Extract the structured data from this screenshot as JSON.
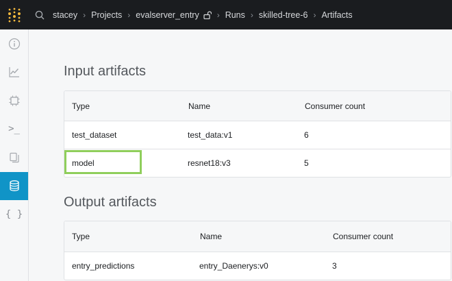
{
  "breadcrumb": {
    "user": "stacey",
    "projects": "Projects",
    "project": "evalserver_entry",
    "runs": "Runs",
    "run": "skilled-tree-6",
    "page": "Artifacts"
  },
  "sidebar": {
    "items": [
      {
        "name": "overview",
        "icon": "info-icon"
      },
      {
        "name": "charts",
        "icon": "line-chart-icon"
      },
      {
        "name": "system",
        "icon": "chip-icon"
      },
      {
        "name": "logs",
        "icon": "terminal-icon",
        "text": ">_"
      },
      {
        "name": "files",
        "icon": "files-icon"
      },
      {
        "name": "artifacts",
        "icon": "database-icon",
        "active": true
      },
      {
        "name": "code",
        "icon": "braces-icon",
        "text": "{ }"
      }
    ]
  },
  "input": {
    "title": "Input artifacts",
    "columns": [
      "Type",
      "Name",
      "Consumer count"
    ],
    "rows": [
      [
        "test_dataset",
        "test_data:v1",
        "6"
      ],
      [
        "model",
        "resnet18:v3",
        "5"
      ]
    ]
  },
  "output": {
    "title": "Output artifacts",
    "columns": [
      "Type",
      "Name",
      "Consumer count"
    ],
    "rows": [
      [
        "entry_predictions",
        "entry_Daenerys:v0",
        "3"
      ]
    ]
  },
  "colors": {
    "topbar": "#1a1c1f",
    "logo": "#f5b93e",
    "active": "#1094c7",
    "highlight": "#8fce5b"
  }
}
